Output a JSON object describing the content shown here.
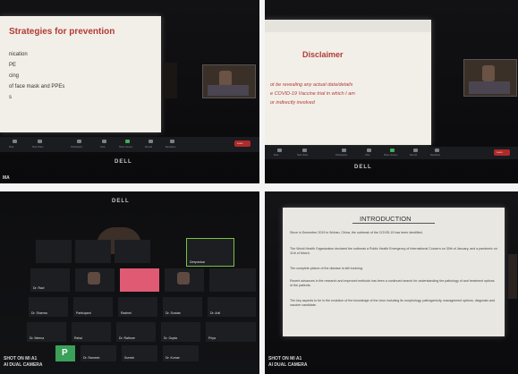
{
  "photos": {
    "top_left": {
      "slide_title": "Strategies for prevention",
      "bullets": [
        "nication",
        "PE",
        "cing",
        "of face mask and PPEs",
        "s"
      ],
      "toolbar": [
        "Mute",
        "Start Video",
        "Participants",
        "Chat",
        "Share Screen",
        "Record",
        "Reactions",
        "Leave"
      ],
      "brand": "DELL",
      "caption": "MA"
    },
    "top_right": {
      "slide_title": "Disclaimer",
      "body_lines": [
        "ot be revealing any actual data/details",
        "e COVID-19 Vaccine trial in which I am",
        "or indirectly involved"
      ],
      "toolbar": [
        "Mute",
        "Start Video",
        "Participants",
        "Chat",
        "Share Screen",
        "Record",
        "Reactions",
        "Leave"
      ],
      "brand": "DELL"
    },
    "bottom_left": {
      "brand": "DELL",
      "caption_line1": "SHOT ON MI A1",
      "caption_line2": "AI DUAL CAMERA",
      "tile_initial": "P",
      "tile_names": [
        "Dr. Ravi",
        "Participant",
        "",
        "Deepankar",
        "Dr. Sharma",
        "Rashmi",
        "",
        "Dr. Sundar",
        "Dr. Anil",
        "Dr. Meena",
        "Dr. Rathore",
        "Rahul",
        "Dr. Gupta",
        "Priya",
        "Dr. Ramesh",
        "Suresh",
        "",
        "Dr. Kumar",
        "",
        ""
      ]
    },
    "bottom_right": {
      "slide_title": "INTRODUCTION",
      "bullets": [
        "Since in December 2019 in Wuhan, China, the outbreak of the COVID-19 has been identified.",
        "The World Health Organization declared the outbreak a Public Health Emergency of International Concern on 30th of January, and a pandemic on 11th of March.",
        "The complete picture of the disease is still evolving.",
        "Recent advances in the research and improved methods has been a continued search for understanding the pathology of and treatment options of the patients.",
        "The key aspects to be in the evolution of the knowledge of the virus including its morphology, pathogenicity, management options, diagnosis and vaccine candidate."
      ],
      "caption_line1": "SHOT ON MI A1",
      "caption_line2": "AI DUAL CAMERA"
    }
  }
}
